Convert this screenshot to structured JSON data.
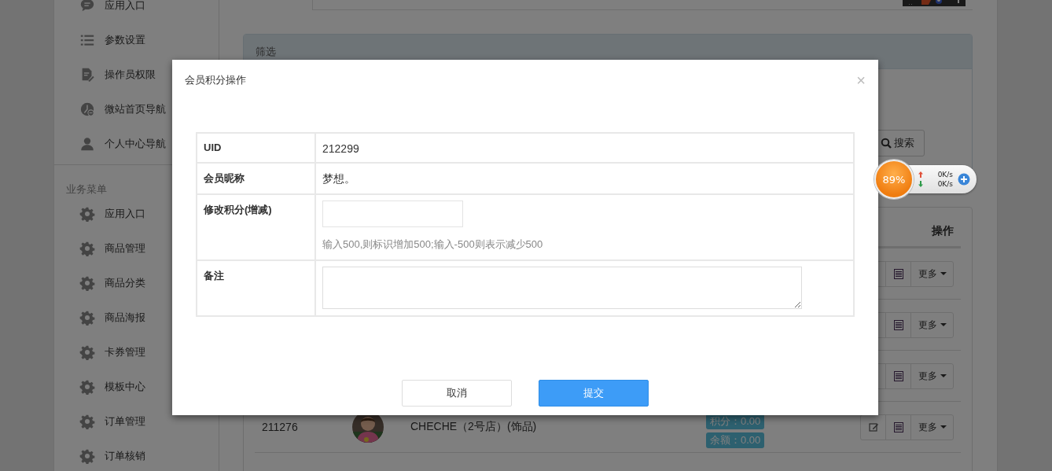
{
  "sidebar": {
    "groups": [
      {
        "items": [
          {
            "label": "应用入口",
            "kind": "chat"
          },
          {
            "label": "参数设置",
            "kind": "list"
          },
          {
            "label": "操作员权限",
            "kind": "doc"
          },
          {
            "label": "微站首页导航",
            "kind": "clock"
          },
          {
            "label": "个人中心导航",
            "kind": "person"
          }
        ]
      },
      {
        "title": "业务菜单",
        "items": [
          {
            "label": "应用入口",
            "kind": "gear"
          },
          {
            "label": "商品管理",
            "kind": "gear"
          },
          {
            "label": "商品分类",
            "kind": "gear"
          },
          {
            "label": "商品海报",
            "kind": "gear"
          },
          {
            "label": "卡券管理",
            "kind": "gear"
          },
          {
            "label": "模板中心",
            "kind": "gear"
          },
          {
            "label": "订单管理",
            "kind": "gear"
          },
          {
            "label": "订单核销",
            "kind": "gear"
          }
        ]
      }
    ]
  },
  "filter_panel": {
    "title": "筛选",
    "search_button": "搜索"
  },
  "table": {
    "action_header": "操作",
    "rows": [
      {
        "more": "更多"
      },
      {
        "more": "更多"
      },
      {
        "more": "更多"
      },
      {
        "uid": "211276",
        "name": "CHECHE（2号店）(饰品)",
        "badges": [
          "积分：0.00",
          "余额：0.00"
        ],
        "more": "更多"
      }
    ]
  },
  "modal": {
    "title": "会员积分操作",
    "close": "×",
    "fields": [
      {
        "kind": "text",
        "label": "UID",
        "value": "212299"
      },
      {
        "kind": "text",
        "label": "会员昵称",
        "value": "梦想。"
      },
      {
        "kind": "input",
        "label": "修改积分(增减)",
        "help": "输入500,则标识增加500;输入-500则表示减少500"
      },
      {
        "kind": "textarea",
        "label": "备注"
      }
    ],
    "buttons": [
      {
        "label": "取消",
        "kind": "default"
      },
      {
        "label": "提交",
        "kind": "primary"
      }
    ]
  },
  "speed_widget": {
    "percent": "89%",
    "upload": "0K/s",
    "download": "0K/s"
  }
}
